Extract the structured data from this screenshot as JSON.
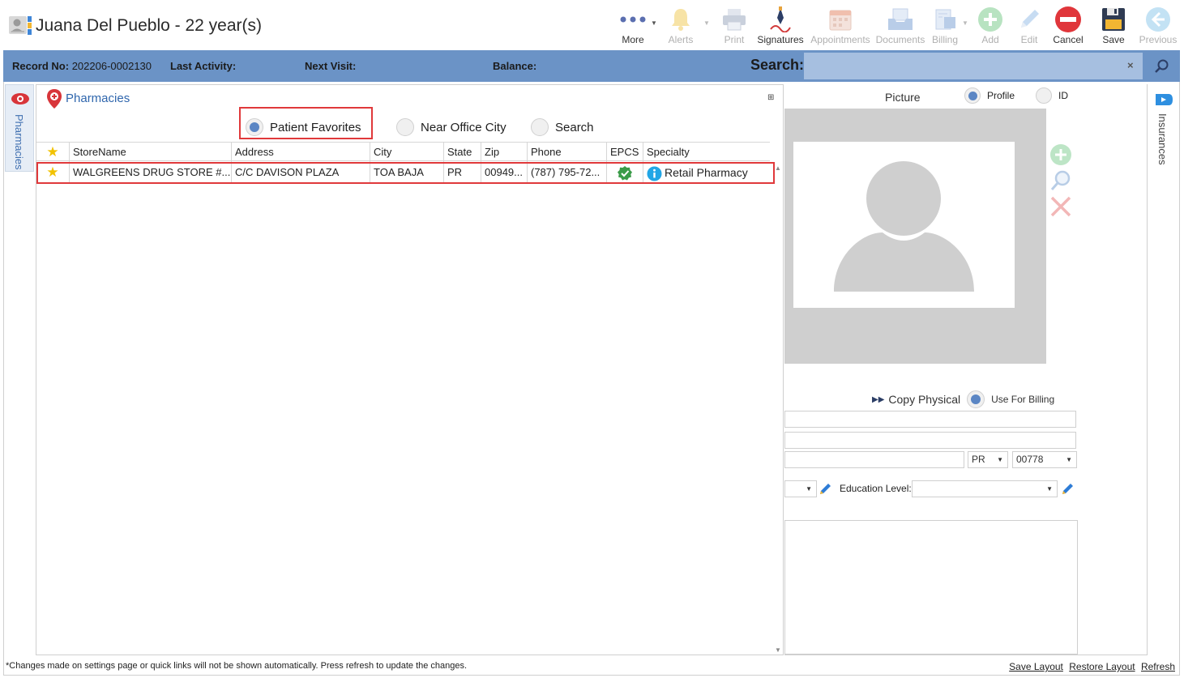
{
  "header": {
    "patient_name": "Juana Del Pueblo - 22 year(s)"
  },
  "toolbar": {
    "more": "More",
    "alerts": "Alerts",
    "print": "Print",
    "signatures": "Signatures",
    "appointments": "Appointments",
    "documents": "Documents",
    "billing": "Billing",
    "add": "Add",
    "edit": "Edit",
    "cancel": "Cancel",
    "save": "Save",
    "previous": "Previous"
  },
  "infobar": {
    "record_label": "Record No:",
    "record_value": "202206-0002130",
    "last_activity_label": "Last Activity:",
    "next_visit_label": "Next Visit:",
    "balance_label": "Balance:",
    "search_label": "Search:",
    "search_clear": "×"
  },
  "side_tabs": {
    "left": "Pharmacies",
    "right": "Insurances"
  },
  "pharmacies": {
    "title": "Pharmacies",
    "dock_glyph": "⊞",
    "filters": [
      {
        "label": "Patient Favorites",
        "selected": true
      },
      {
        "label": "Near Office City",
        "selected": false
      },
      {
        "label": "Search",
        "selected": false
      }
    ],
    "columns": [
      "★",
      "StoreName",
      "Address",
      "City",
      "State",
      "Zip",
      "Phone",
      "EPCS",
      "Specialty"
    ],
    "rows": [
      {
        "favorite": "★",
        "store": "WALGREENS DRUG STORE #...",
        "address": "C/C DAVISON PLAZA",
        "city": "TOA BAJA",
        "state": "PR",
        "zip": "00949...",
        "phone": "(787) 795-72...",
        "epcs": "check-icon",
        "specialty": "Retail Pharmacy"
      }
    ]
  },
  "picture": {
    "label": "Picture",
    "profile": "Profile",
    "id": "ID",
    "profile_selected": true
  },
  "address": {
    "copy_physical": "Copy Physical",
    "use_for_billing": "Use For Billing",
    "state": "PR",
    "zip": "00778",
    "education_label": "Education Level:"
  },
  "footer": {
    "note": "*Changes made on settings page or quick links will not be shown automatically. Press refresh to update the changes.",
    "save_layout": "Save Layout",
    "restore_layout": "Restore Layout",
    "refresh": "Refresh"
  },
  "colors": {
    "infobar": "#6b93c6",
    "search_field": "#a6bfe0",
    "highlight": "#e0393b",
    "link_blue": "#2f66ad"
  }
}
